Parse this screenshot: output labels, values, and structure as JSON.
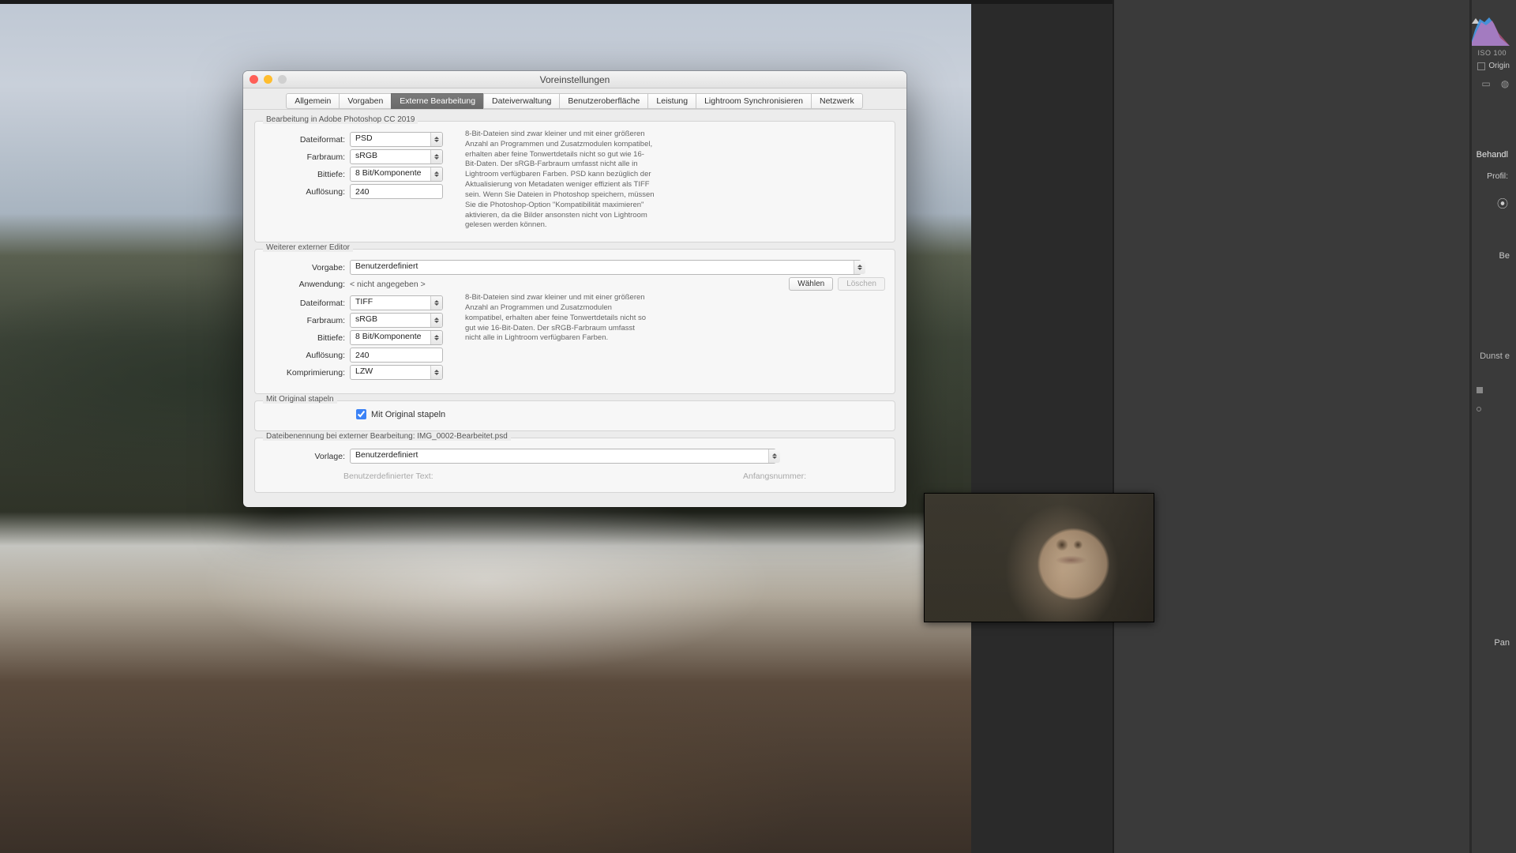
{
  "right": {
    "iso": "ISO 100",
    "origin": "Origin",
    "behandlung": "Behandl",
    "profil": "Profil:",
    "belichtung": "Be",
    "dunst": "Dunst e",
    "panel": "Pan"
  },
  "dialog": {
    "title": "Voreinstellungen",
    "tabs": [
      "Allgemein",
      "Vorgaben",
      "Externe Bearbeitung",
      "Dateiverwaltung",
      "Benutzeroberfläche",
      "Leistung",
      "Lightroom Synchronisieren",
      "Netzwerk"
    ],
    "active_tab": 2,
    "sections": {
      "photoshop": {
        "title": "Bearbeitung in Adobe Photoshop CC 2019",
        "labels": {
          "dateiformat": "Dateiformat:",
          "farbraum": "Farbraum:",
          "bittiefe": "Bittiefe:",
          "aufloesung": "Auflösung:"
        },
        "values": {
          "dateiformat": "PSD",
          "farbraum": "sRGB",
          "bittiefe": "8 Bit/Komponente",
          "aufloesung": "240"
        },
        "desc": "8-Bit-Dateien sind zwar kleiner und mit einer größeren Anzahl an Programmen und Zusatzmodulen kompatibel, erhalten aber feine Tonwertdetails nicht so gut wie 16-Bit-Daten. Der sRGB-Farbraum umfasst nicht alle in Lightroom verfügbaren Farben. PSD kann bezüglich der Aktualisierung von Metadaten weniger effizient als TIFF sein. Wenn Sie Dateien in Photoshop speichern, müssen Sie die Photoshop-Option \"Kompatibilität maximieren\" aktivieren, da die Bilder ansonsten nicht von Lightroom gelesen werden können."
      },
      "external": {
        "title": "Weiterer externer Editor",
        "labels": {
          "vorgabe": "Vorgabe:",
          "anwendung": "Anwendung:",
          "dateiformat": "Dateiformat:",
          "farbraum": "Farbraum:",
          "bittiefe": "Bittiefe:",
          "aufloesung": "Auflösung:",
          "komprimierung": "Komprimierung:"
        },
        "values": {
          "vorgabe": "Benutzerdefiniert",
          "anwendung": "< nicht angegeben >",
          "dateiformat": "TIFF",
          "farbraum": "sRGB",
          "bittiefe": "8 Bit/Komponente",
          "aufloesung": "240",
          "komprimierung": "LZW"
        },
        "buttons": {
          "choose": "Wählen",
          "delete": "Löschen"
        },
        "desc": "8-Bit-Dateien sind zwar kleiner und mit einer größeren Anzahl an Programmen und Zusatzmodulen kompatibel, erhalten aber feine Tonwertdetails nicht so gut wie 16-Bit-Daten. Der sRGB-Farbraum umfasst nicht alle in Lightroom verfügbaren Farben."
      },
      "stack": {
        "title": "Mit Original stapeln",
        "checkbox": "Mit Original stapeln",
        "checked": true
      },
      "naming": {
        "title": "Dateibenennung bei externer Bearbeitung: IMG_0002-Bearbeitet.psd",
        "labels": {
          "vorlage": "Vorlage:"
        },
        "values": {
          "vorlage": "Benutzerdefiniert"
        },
        "custom_text_label": "Benutzerdefinierter Text:",
        "start_number_label": "Anfangsnummer:"
      }
    }
  }
}
